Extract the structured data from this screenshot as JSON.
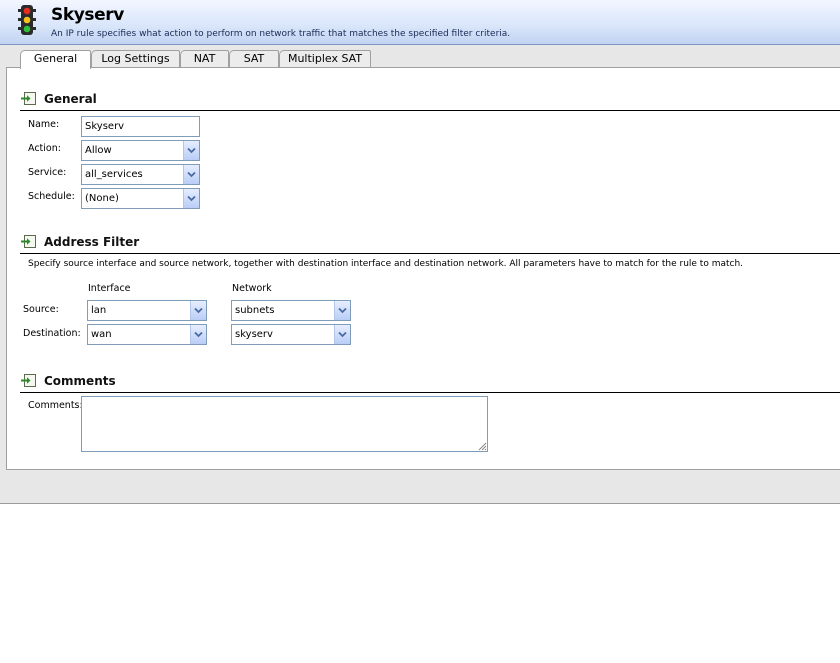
{
  "header": {
    "title": "Skyserv",
    "subtitle": "An IP rule specifies what action to perform on network traffic that matches the specified filter criteria.",
    "icon": "traffic-light-icon"
  },
  "tabs": [
    {
      "label": "General",
      "active": true
    },
    {
      "label": "Log Settings",
      "active": false
    },
    {
      "label": "NAT",
      "active": false
    },
    {
      "label": "SAT",
      "active": false
    },
    {
      "label": "Multiplex SAT",
      "active": false
    }
  ],
  "general": {
    "heading": "General",
    "name_label": "Name:",
    "name_value": "Skyserv",
    "action_label": "Action:",
    "action_value": "Allow",
    "service_label": "Service:",
    "service_value": "all_services",
    "schedule_label": "Schedule:",
    "schedule_value": "(None)"
  },
  "address_filter": {
    "heading": "Address Filter",
    "description": "Specify source interface and source network, together with destination interface and destination network. All parameters have to match for the rule to match.",
    "col_interface": "Interface",
    "col_network": "Network",
    "source_label": "Source:",
    "source_interface": "lan",
    "source_network": "subnets",
    "destination_label": "Destination:",
    "destination_interface": "wan",
    "destination_network": "skyserv"
  },
  "comments": {
    "heading": "Comments",
    "label": "Comments:",
    "value": ""
  },
  "colors": {
    "header_top": "#f2f6ff",
    "header_bottom": "#c2d4f2",
    "field_border": "#7f9db9",
    "app_background": "#e7e7e7"
  }
}
